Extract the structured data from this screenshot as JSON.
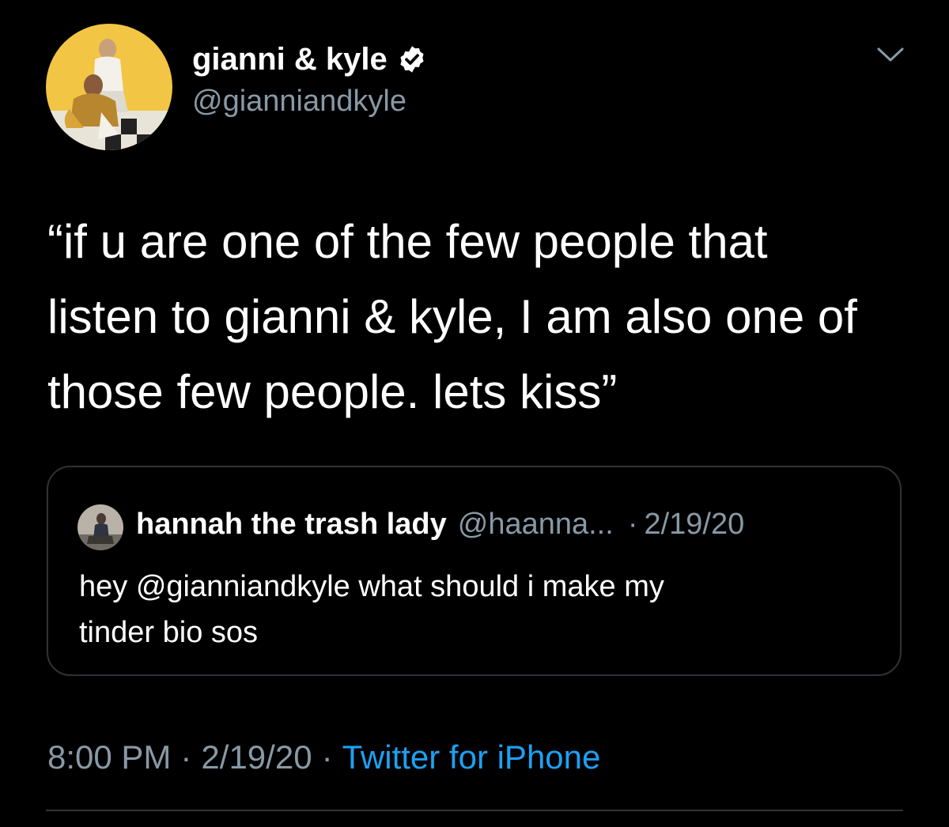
{
  "author": {
    "display_name": "gianni & kyle",
    "handle": "@gianniandkyle",
    "verified": true,
    "avatar_icon": "profile-photo"
  },
  "tweet": {
    "text_lines": [
      "“if u are one of the few people that",
      "listen to gianni & kyle, I am also one of",
      "those few people. lets kiss”"
    ]
  },
  "quoted_tweet": {
    "display_name": "hannah the trash lady",
    "handle": "@haanna...",
    "separator": "·",
    "date": "2/19/20",
    "text_lines": [
      "hey @gianniandkyle what should i make my",
      "tinder bio sos"
    ],
    "avatar_icon": "profile-photo"
  },
  "meta": {
    "time": "8:00 PM",
    "separator": "·",
    "date": "2/19/20",
    "source": "Twitter for iPhone"
  },
  "colors": {
    "background": "#000000",
    "text_primary": "#ffffff",
    "text_secondary": "#8899a6",
    "accent": "#1da1f2",
    "border": "#2f3336"
  }
}
